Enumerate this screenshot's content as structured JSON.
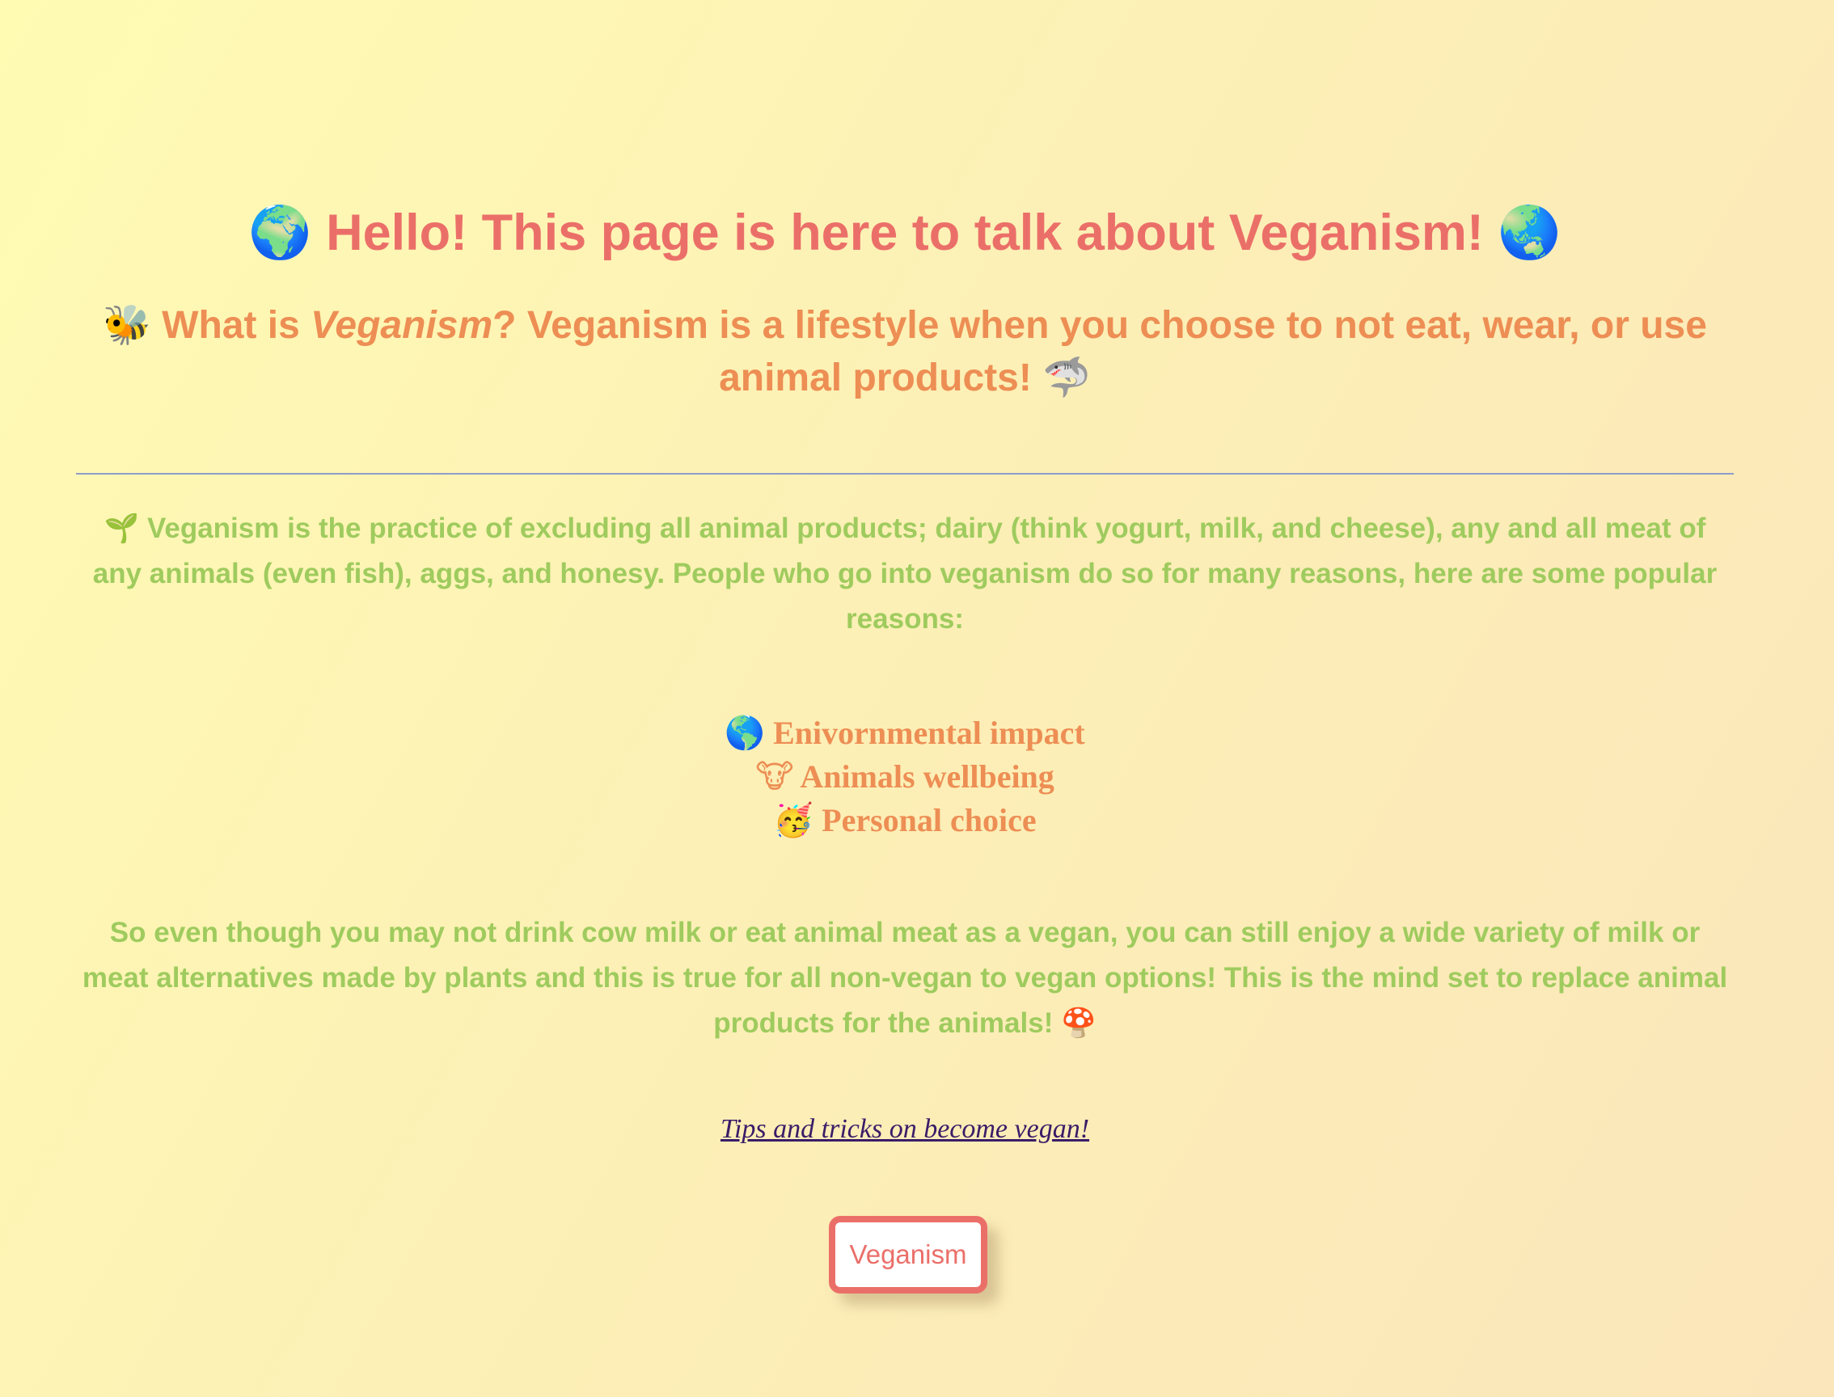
{
  "header": {
    "emoji_left": "🌍",
    "title": "Hello! This page is here to talk about Veganism!",
    "emoji_right": "🌏"
  },
  "intro": {
    "emoji_left": "🐝",
    "prefix": "What is ",
    "emphasis": "Veganism",
    "suffix": "? Veganism is a lifestyle when you choose to not eat, wear, or use animal products!",
    "emoji_right": "🦈"
  },
  "description": {
    "emoji": "🌱",
    "text": "Veganism is the practice of excluding all animal products; dairy (think yogurt, milk, and cheese), any and all meat of any animals (even fish), aggs, and honesy. People who go into veganism do so for many reasons, here are some popular reasons:"
  },
  "reasons": [
    {
      "emoji": "🌎",
      "label": "Enivornmental impact"
    },
    {
      "emoji": "🐮",
      "label": "Animals wellbeing"
    },
    {
      "emoji": "🥳",
      "label": "Personal choice"
    }
  ],
  "closing": {
    "text": "So even though you may not drink cow milk or eat animal meat as a vegan, you can still enjoy a wide variety of milk or meat alternatives made by plants and this is true for all non-vegan to vegan options! This is the mind set to replace animal products for the animals!",
    "emoji": "🍄"
  },
  "link": {
    "label": "Tips and tricks on become vegan!"
  },
  "button": {
    "label": "Veganism"
  },
  "colors": {
    "title": "#eb6f69",
    "subtitle": "#ed8e54",
    "body": "#9fcb5e",
    "link": "#3a1c68",
    "divider": "#8d9dc9"
  }
}
